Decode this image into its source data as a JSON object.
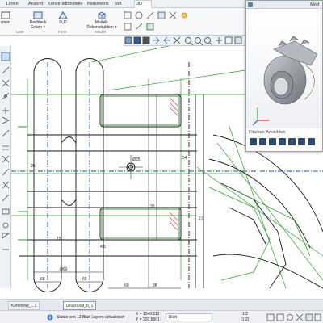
{
  "ribbon": {
    "tabs": [
      {
        "label": "Linien"
      },
      {
        "label": "Ansicht"
      },
      {
        "label": "Konstruktionsteile"
      },
      {
        "label": "Parametrik"
      },
      {
        "label": "RM"
      },
      {
        "label": "3D"
      }
    ],
    "active_tab_index": 5,
    "buttons": {
      "first": "rmen",
      "rechteck_line1": "Rechteck",
      "rechteck_line2": "Ecken ▾",
      "d2d": "D₂D",
      "modell_line1": "Modell-",
      "modell_line2": "Rekonstruktion ▾"
    },
    "group_labels": [
      "Linie",
      "Form",
      "Modell"
    ]
  },
  "model_window": {
    "title": "Mod",
    "faces_label": "Flächen-Ansichten",
    "accent": "#2c4a73"
  },
  "drawing": {
    "dimensions": [
      "Ø60",
      "68",
      "65",
      "60",
      "38",
      "25",
      "Ø25",
      "35",
      "54",
      "2,5",
      "15",
      "4,5"
    ],
    "colors": {
      "geometry": "#1a1a1a",
      "construction": "#2f9e2f",
      "selection": "#3e8e3e",
      "center": "#1e4bb0",
      "hatch_red": "#c73a3a"
    }
  },
  "document_tabs": [
    {
      "label": "Kettenrad_...1",
      "active": false
    },
    {
      "label": "02020008_b_1",
      "active": true
    }
  ],
  "status": {
    "message": "Status von 12 Blatt Layern aktualisiert",
    "x_coord": "X = 1540.112",
    "y_coord": "Y = 320.5501",
    "sheet_field": "Blatt",
    "scale": "1:2",
    "scale_sub": "(1:2)"
  }
}
